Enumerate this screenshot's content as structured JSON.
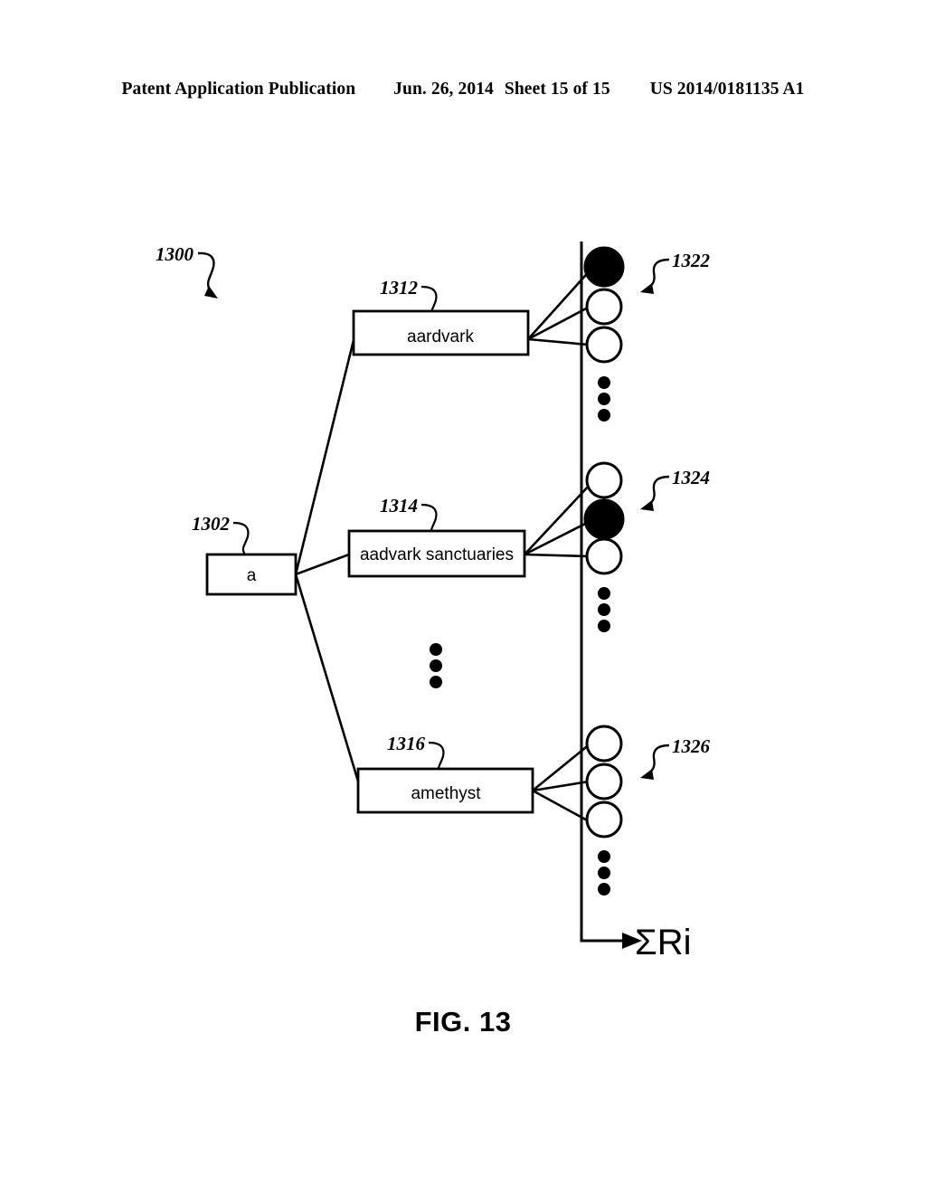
{
  "header": {
    "publication": "Patent Application Publication",
    "date": "Jun. 26, 2014",
    "sheet": "Sheet 15 of 15",
    "number": "US 2014/0181135 A1"
  },
  "figure": {
    "caption": "FIG. 13",
    "diagram_ref": "1300",
    "root": {
      "ref": "1302",
      "label": "a"
    },
    "terms": [
      {
        "ref": "1312",
        "label": "aardvark"
      },
      {
        "ref": "1314",
        "label": "aadvark sanctuaries"
      },
      {
        "ref": "1316",
        "label": "amethyst"
      }
    ],
    "result_groups": [
      {
        "ref": "1322",
        "circles": [
          "filled",
          "hollow",
          "hollow"
        ],
        "ellipsis": true
      },
      {
        "ref": "1324",
        "circles": [
          "hollow",
          "filled",
          "hollow"
        ],
        "ellipsis": true
      },
      {
        "ref": "1326",
        "circles": [
          "hollow",
          "hollow",
          "hollow"
        ],
        "ellipsis": true
      }
    ],
    "middle_ellipsis": true,
    "output_label": "ΣRi"
  },
  "colors": {
    "ink": "#000000",
    "paper": "#ffffff"
  }
}
